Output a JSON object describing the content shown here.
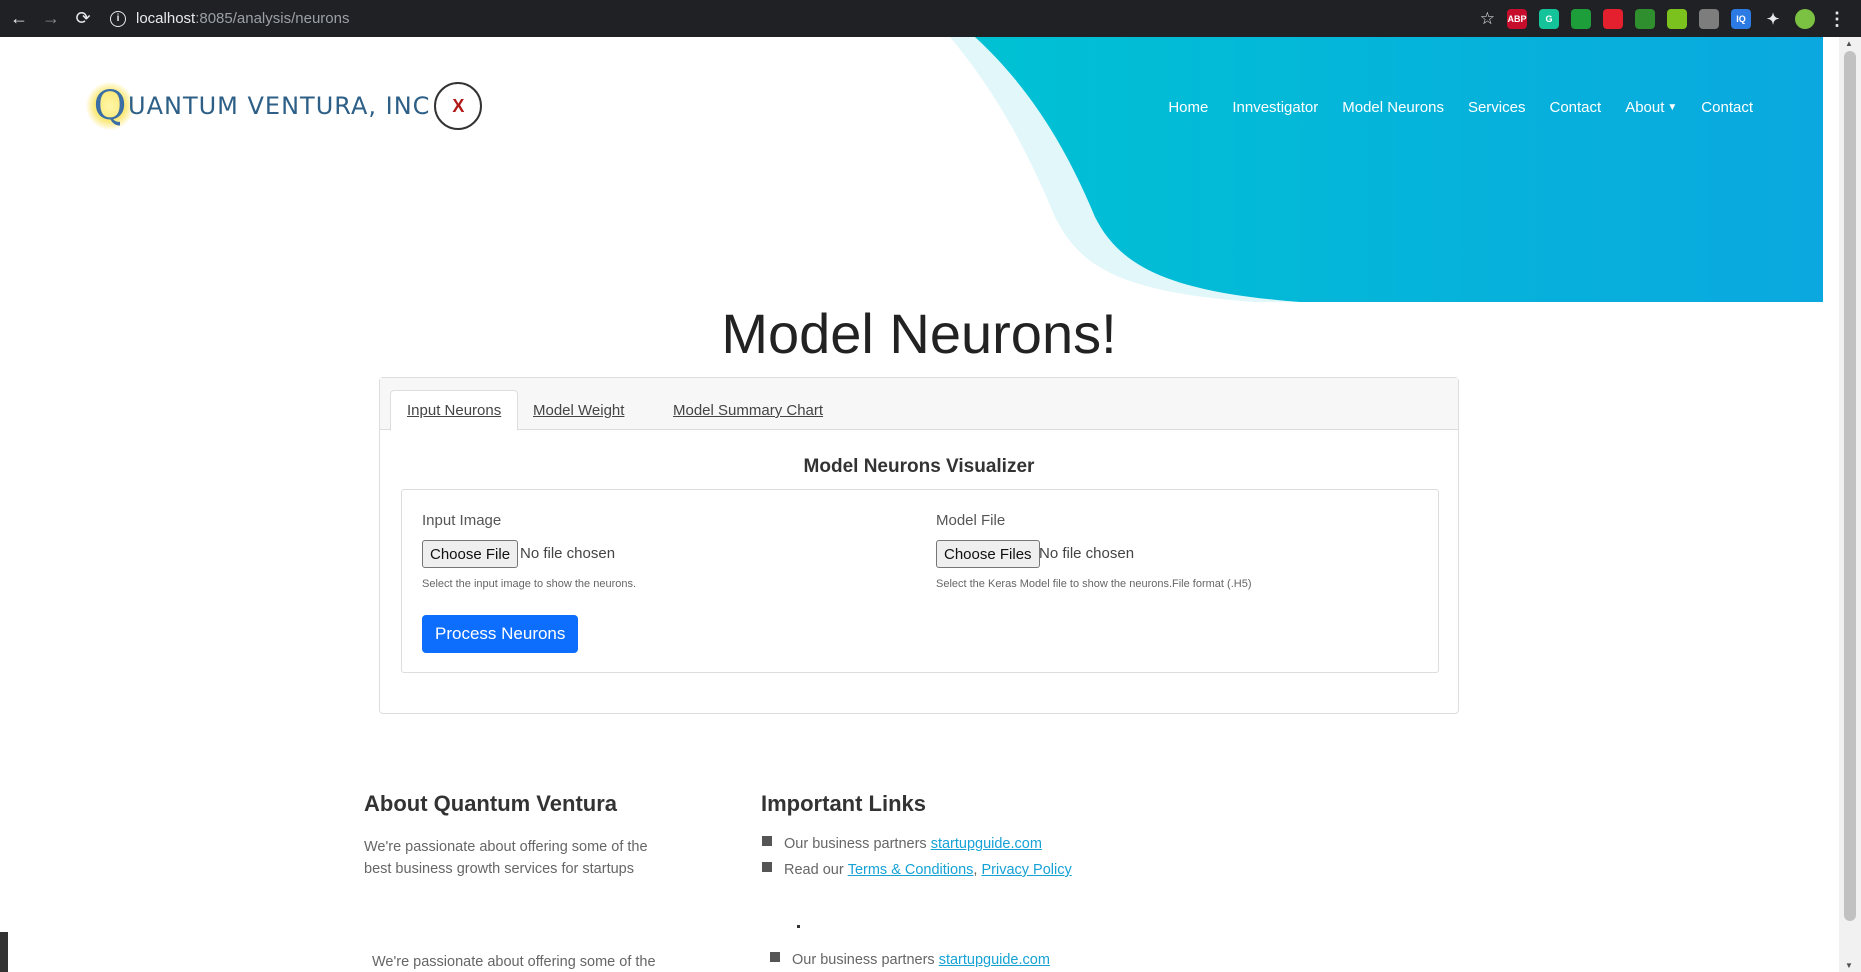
{
  "browser": {
    "url_host": "localhost",
    "url_path": ":8085/analysis/neurons",
    "extensions": [
      {
        "name": "abp-icon",
        "label": "ABP",
        "color": "#c70d2c"
      },
      {
        "name": "grammarly-icon",
        "label": "G",
        "color": "#15c39a"
      },
      {
        "name": "green-drop-icon",
        "label": "",
        "color": "#1e9e3a"
      },
      {
        "name": "red-shield-icon",
        "label": "",
        "color": "#e5202e"
      },
      {
        "name": "search-ext-icon",
        "label": "",
        "color": "#2f8f2f"
      },
      {
        "name": "cube-ext-icon",
        "label": "",
        "color": "#7bc21e"
      },
      {
        "name": "box-ext-icon",
        "label": "",
        "color": "#7d7d7d"
      },
      {
        "name": "iq-ext-icon",
        "label": "IQ",
        "color": "#2c7be5"
      }
    ]
  },
  "logo": {
    "initial": "Q",
    "name": "UANTUM VENTURA, INC"
  },
  "nav": {
    "items": [
      "Home",
      "Innvestigator",
      "Model Neurons",
      "Services",
      "Contact",
      "About",
      "Contact"
    ]
  },
  "page": {
    "title": "Model Neurons!"
  },
  "tabs": [
    "Input Neurons",
    "Model Weight",
    "Model Summary Chart"
  ],
  "visualizer": {
    "title": "Model Neurons Visualizer",
    "input_image": {
      "label": "Input Image",
      "button": "Choose File",
      "status": "No file chosen",
      "help": "Select the input image to show the neurons."
    },
    "model_file": {
      "label": "Model File",
      "button": "Choose Files",
      "status": "No file chosen",
      "help": "Select the Keras Model file to show the neurons.File format (.H5)"
    },
    "process_button": "Process Neurons"
  },
  "footer": {
    "about_title": "About Quantum Ventura",
    "about_text": "We're passionate about offering some of the best business growth services for startups",
    "links_title": "Important Links",
    "partners_text": "Our business partners ",
    "partners_link": "startupguide.com",
    "read_text": "Read our ",
    "terms_link": "Terms & Conditions",
    "comma": ", ",
    "privacy_link": "Privacy Policy",
    "dup_about_text": "We're passionate about offering some of the",
    "dup_partners_text": "Our business partners ",
    "dup_partners_link": "startupguide.com"
  },
  "colors": {
    "wave_dark": "#00bcd4",
    "wave_light": "#e2f7fa",
    "accent": "#0d6efd",
    "link": "#17a2d6"
  }
}
